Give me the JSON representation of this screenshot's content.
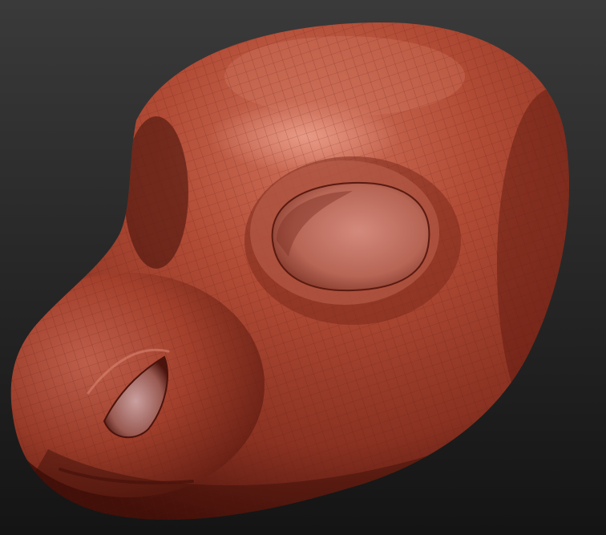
{
  "viewport": {
    "subject": "head-sculpt",
    "background_top_color": "#3a3a3a",
    "background_bottom_color": "#141414",
    "material_base_color": "#a8412c",
    "material_highlight_color": "#d98470",
    "material_shadow_color": "#4a120b",
    "wireframe_color": "#5a1a10"
  }
}
